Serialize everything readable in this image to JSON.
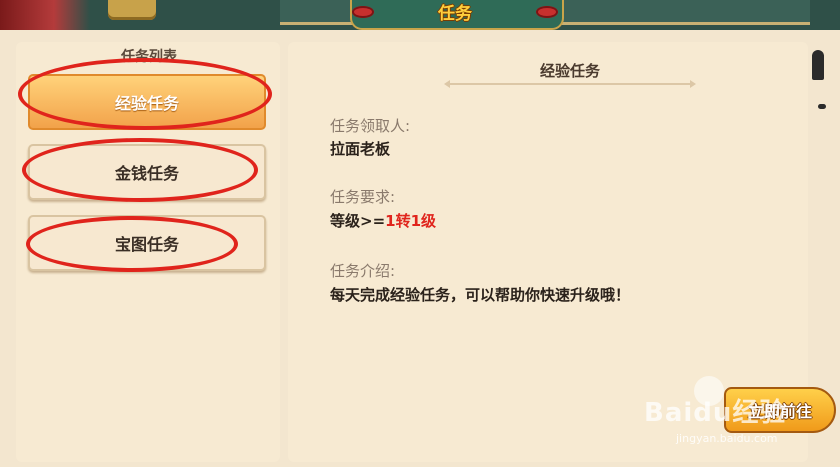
{
  "header": {
    "title": "任务"
  },
  "task_list": {
    "title": "任务列表",
    "tabs": [
      {
        "label": "经验任务",
        "active": true
      },
      {
        "label": "金钱任务",
        "active": false
      },
      {
        "label": "宝图任务",
        "active": false
      }
    ]
  },
  "detail": {
    "title": "经验任务",
    "receiver_label": "任务领取人:",
    "receiver_value": "拉面老板",
    "requirement_label": "任务要求:",
    "requirement_prefix": "等级>=",
    "requirement_value": "1转1级",
    "intro_label": "任务介绍:",
    "intro_value": "每天完成经验任务，可以帮助你快速升级哦！"
  },
  "go_button": {
    "label": "立即前往"
  },
  "watermark": {
    "brand": "Baidu经验",
    "url": "jingyan.baidu.com"
  },
  "colors": {
    "accent_red": "#e0241c",
    "active_tab": "#f2a24a",
    "title_gold": "#ffcf3d"
  }
}
